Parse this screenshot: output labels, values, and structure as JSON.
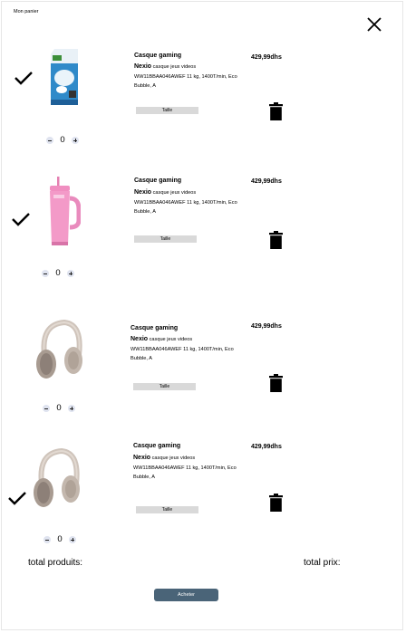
{
  "header": {
    "title": "Mon panier"
  },
  "cart": {
    "items": [
      {
        "name": "Casque gaming",
        "price": "429,99dhs",
        "brand": "Nexio",
        "subtitle": "casque jeux videos",
        "spec": "WW11BBAA046AWEF 11 kg, 1400T/min, Eco Bubble, A",
        "size_label": "Taille",
        "quantity": "0",
        "checked": true,
        "image": "milk-carton"
      },
      {
        "name": "Casque gaming",
        "price": "429,99dhs",
        "brand": "Nexio",
        "subtitle": "casque jeux videos",
        "spec": "WW11BBAA046AWEF 11 kg, 1400T/min, Eco Bubble, A",
        "size_label": "Taille",
        "quantity": "0",
        "checked": true,
        "image": "pink-tumbler"
      },
      {
        "name": "Casque gaming",
        "price": "429,99dhs",
        "brand": "Nexio",
        "subtitle": "casque jeux videos",
        "spec": "WW11BBAA046AWEF 11 kg, 1400T/min, Eco Bubble, A",
        "size_label": "Taille",
        "quantity": "0",
        "checked": false,
        "image": "headphones"
      },
      {
        "name": "Casque gaming",
        "price": "429,99dhs",
        "brand": "Nexio",
        "subtitle": "casque jeux videos",
        "spec": "WW11BBAA046AWEF 11 kg, 1400T/min, Eco Bubble, A",
        "size_label": "Taille",
        "quantity": "0",
        "checked": true,
        "image": "headphones"
      }
    ]
  },
  "footer": {
    "total_products_label": "total produits:",
    "total_price_label": "total prix:",
    "buy_label": "Acheter"
  },
  "colors": {
    "buy_button": "#4a6478",
    "size_button": "#d9d9d9",
    "stepper": "#dfe3ef"
  },
  "icons": [
    "close-icon",
    "check-icon",
    "trash-icon",
    "minus-icon",
    "plus-icon"
  ]
}
